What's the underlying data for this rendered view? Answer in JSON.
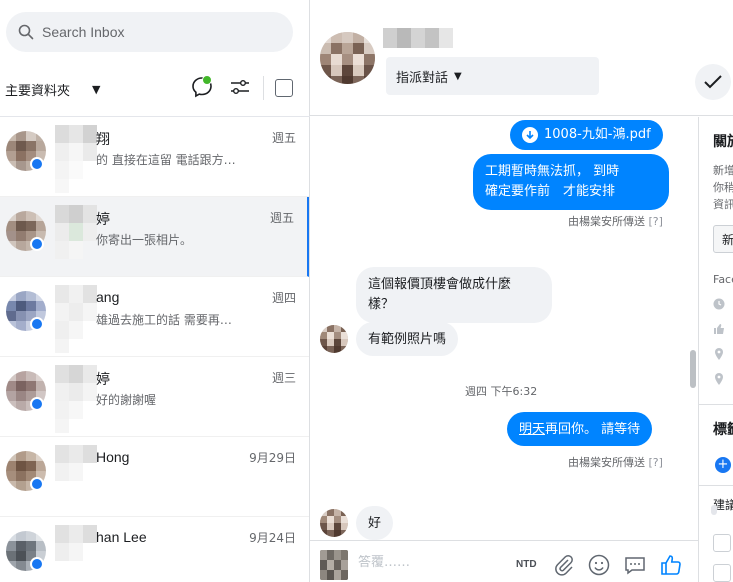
{
  "search": {
    "placeholder": "Search Inbox"
  },
  "filter": {
    "folder_label": "主要資料夾"
  },
  "conversations": [
    {
      "name": "翔",
      "snippet": "的 直接在這留 電話跟方…",
      "date": "週五"
    },
    {
      "name": "婷",
      "snippet": "你寄出一張相片。",
      "date": "週五"
    },
    {
      "name": "ang",
      "snippet": "雄過去施工的話 需要再…",
      "date": "週四"
    },
    {
      "name": "婷",
      "snippet": "好的謝謝喔",
      "date": "週三"
    },
    {
      "name": "Hong",
      "snippet": "",
      "date": "9月29日"
    },
    {
      "name": "han Lee",
      "snippet": "",
      "date": "9月24日"
    }
  ],
  "thread": {
    "assign_label": "指派對話",
    "messages": {
      "file_name": "1008-九如-鴻.pdf",
      "out1_line1": "工期暫時無法抓， 到時",
      "out1_line2": "確定要作前　才能安排",
      "sent_by_1": "由楊棠安所傳送",
      "q1": "[?]",
      "in1_line1": "這個報價頂樓會做成什麼",
      "in1_line2": "樣？",
      "in2": "有範例照片嗎",
      "timestamp": "週四 下午6:32",
      "out2_link": "明天",
      "out2_rest": "再回你。 請等待",
      "sent_by_2": "由楊棠安所傳送",
      "q2": "[?]",
      "in3": "好"
    }
  },
  "composer": {
    "placeholder": "答覆……",
    "currency": "NTD"
  },
  "right_panel": {
    "about_title": "關於",
    "about_lines": [
      "新增",
      "你稍",
      "資訊"
    ],
    "button_label": "新",
    "facebook_label": "Face",
    "labels_title": "標籤",
    "notes_title": "建議"
  },
  "colors": {
    "accent": "#1877f2",
    "bubble_out": "#0084ff",
    "bubble_in": "#f0f2f5",
    "online": "#42b72a"
  }
}
